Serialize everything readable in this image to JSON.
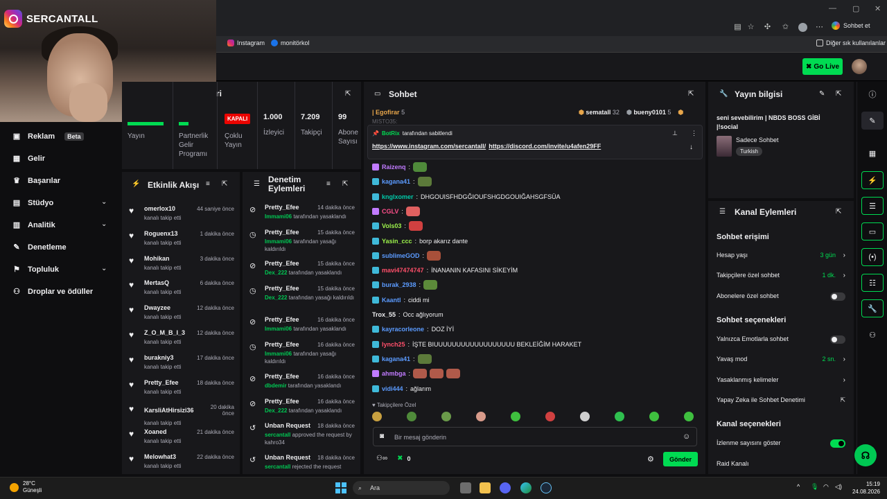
{
  "webcam": {
    "instagram_name": "SERCANTALL"
  },
  "bookmarks": {
    "items": [
      "Instagram",
      "monitörkol"
    ],
    "other": "Diğer sık kullanılanlar"
  },
  "browser": {
    "sohbet_et": "Sohbet et"
  },
  "appbar": {
    "go_live": "Go Live"
  },
  "nav": {
    "items": [
      {
        "label": "Reklam",
        "badge": "Beta"
      },
      {
        "label": "Gelir"
      },
      {
        "label": "Başarılar"
      },
      {
        "label": "Stüdyo"
      },
      {
        "label": "Analitik"
      },
      {
        "label": "Denetleme"
      },
      {
        "label": "Topluluk"
      },
      {
        "label": "Droplar ve ödüller"
      }
    ]
  },
  "stats": {
    "partial_title": "ri",
    "cols": [
      {
        "label": "Yayın",
        "value": ""
      },
      {
        "label": "Partnerlik Gelir Programı",
        "value": ""
      },
      {
        "label": "Çoklu Yayın",
        "value": "KAPALI"
      },
      {
        "label": "İzleyici",
        "value": "1.000"
      },
      {
        "label": "Takipçi",
        "value": "7.209"
      },
      {
        "label": "Abone Sayısı",
        "value": "99"
      }
    ]
  },
  "activity": {
    "title": "Etkinlik Akışı",
    "subtitle": "kanalı takip etti",
    "rows": [
      {
        "name": "omerlox10",
        "time": "44 saniye önce"
      },
      {
        "name": "Roguenx13",
        "time": "1 dakika önce"
      },
      {
        "name": "Mohikan",
        "time": "3 dakika önce"
      },
      {
        "name": "MertasQ",
        "time": "6 dakika önce"
      },
      {
        "name": "Dwayzee",
        "time": "12 dakika önce"
      },
      {
        "name": "Z_O_M_B_I_3",
        "time": "12 dakika önce"
      },
      {
        "name": "burakniy3",
        "time": "17 dakika önce"
      },
      {
        "name": "Pretty_Efee",
        "time": "18 dakika önce"
      },
      {
        "name": "KarsliAtHirsizi36",
        "time": "20 dakika önce"
      },
      {
        "name": "Xoaned",
        "time": "21 dakika önce"
      },
      {
        "name": "Melowhat3",
        "time": "22 dakika önce"
      }
    ]
  },
  "moderation": {
    "title": "Denetim Eylemleri",
    "rows": [
      {
        "name": "Pretty_Efee",
        "time": "14 dakika önce",
        "actor": "Immami06",
        "desc": "tarafından yasaklandı"
      },
      {
        "name": "Pretty_Efee",
        "time": "15 dakika önce",
        "actor": "Immami06",
        "desc": "tarafından yasağı kaldırıldı"
      },
      {
        "name": "Pretty_Efee",
        "time": "15 dakika önce",
        "actor": "Dex_222",
        "desc": "tarafından yasaklandı"
      },
      {
        "name": "Pretty_Efee",
        "time": "15 dakika önce",
        "actor": "Dex_222",
        "desc": "tarafından yasağı kaldırıldı"
      },
      {
        "name": "Pretty_Efee",
        "time": "16 dakika önce",
        "actor": "Immami06",
        "desc": "tarafından yasaklandı"
      },
      {
        "name": "Pretty_Efee",
        "time": "16 dakika önce",
        "actor": "Immami06",
        "desc": "tarafından yasağı kaldırıldı"
      },
      {
        "name": "Pretty_Efee",
        "time": "16 dakika önce",
        "actor": "dbdemir",
        "desc": "tarafından yasaklandı"
      },
      {
        "name": "Pretty_Efee",
        "time": "16 dakika önce",
        "actor": "Dex_222",
        "desc": "tarafından yasaklandı"
      },
      {
        "name": "Unban Request",
        "time": "18 dakika önce",
        "actor": "sercantall",
        "desc": "approved the request by kahro34"
      },
      {
        "name": "Unban Request",
        "time": "18 dakika önce",
        "actor": "sercantall",
        "desc": "rejected the request"
      }
    ]
  },
  "chat": {
    "title": "Sohbet",
    "top_user": "Egofirar",
    "top_count": "5",
    "partial_user": "MISTO35:",
    "leaders": [
      {
        "name": "sematall",
        "count": "32"
      },
      {
        "name": "bueny0101",
        "count": "5"
      }
    ],
    "pinned": {
      "by": "BotRix",
      "suffix": "tarafından sabitlendi",
      "link1": "https://www.instagram.com/sercantall/",
      "link2": "https://discord.com/invite/u4afen29FF"
    },
    "messages": [
      {
        "user": "Raizenq",
        "text": "",
        "color": "#c17bff"
      },
      {
        "user": "kagana41",
        "text": "",
        "color": "#5b9bff"
      },
      {
        "user": "knglxomer",
        "text": "DHGOUISFHDGĞIOUFSHGDGOUIĞAHSGFSÜA",
        "color": "#00c8a8"
      },
      {
        "user": "CGLV",
        "text": "",
        "color": "#ff4f8b"
      },
      {
        "user": "Vols03",
        "text": "",
        "color": "#9cf24b"
      },
      {
        "user": "Yasin_ccc",
        "text": "borp akarız dante",
        "color": "#9cf24b"
      },
      {
        "user": "sublimeGOD",
        "text": "",
        "color": "#5b9bff"
      },
      {
        "user": "mavi47474747",
        "text": "İNANANIN KAFASINI SİKEYİM",
        "color": "#ff4f6a"
      },
      {
        "user": "burak_2938",
        "text": "",
        "color": "#5b9bff"
      },
      {
        "user": "Kaantl",
        "text": "ciddi mi",
        "color": "#5b9bff"
      },
      {
        "user": "Trox_55",
        "text": "Occ ağlıyorum",
        "color": "#efeff1"
      },
      {
        "user": "kayracorleone",
        "text": "DOZ İYİ",
        "color": "#5b9bff"
      },
      {
        "user": "lynch25",
        "text": "İŞTE BIUUUUUUUUUUUUUUUUUU BEKLEİĞİM HARAKET",
        "color": "#ff4f6a"
      },
      {
        "user": "kagana41",
        "text": "",
        "color": "#5b9bff"
      },
      {
        "user": "ahmbga",
        "text": "",
        "color": "#c17bff"
      },
      {
        "user": "vidi444",
        "text": "ağlarım",
        "color": "#5b9bff"
      }
    ],
    "followers_only": "Takipçilere Özel",
    "placeholder": "Bir mesaj gönderin",
    "points": "0",
    "send": "Gönder"
  },
  "stream_info": {
    "title": "Yayın bilgisi",
    "stream_title": "seni sevebilirim | NBDS BOSS GİBİ |!social",
    "category": "Sadece Sohbet",
    "tag": "Turkish"
  },
  "channel_actions": {
    "title": "Kanal Eylemleri",
    "chat_access": "Sohbet erişimi",
    "account_age": {
      "label": "Hesap yaşı",
      "value": "3 gün"
    },
    "followers_chat": {
      "label": "Takipçilere özel sohbet",
      "value": "1 dk."
    },
    "subs_chat": {
      "label": "Abonelere özel sohbet"
    },
    "chat_options": "Sohbet seçenekleri",
    "emote_only": {
      "label": "Yalnızca Emotlarla sohbet"
    },
    "slow_mode": {
      "label": "Yavaş mod",
      "value": "2 sn."
    },
    "banned_words": {
      "label": "Yasaklanmış kelimeler"
    },
    "ai_mod": {
      "label": "Yapay Zeka ile Sohbet Denetimi"
    },
    "channel_options": "Kanal seçenekleri",
    "show_viewers": {
      "label": "İzlenme sayısını göster"
    },
    "raid": {
      "label": "Raid Kanalı"
    }
  },
  "taskbar": {
    "temp": "28°C",
    "weather": "Güneşli",
    "search": "Ara",
    "time": "15:19",
    "date": "24.08.2026"
  }
}
